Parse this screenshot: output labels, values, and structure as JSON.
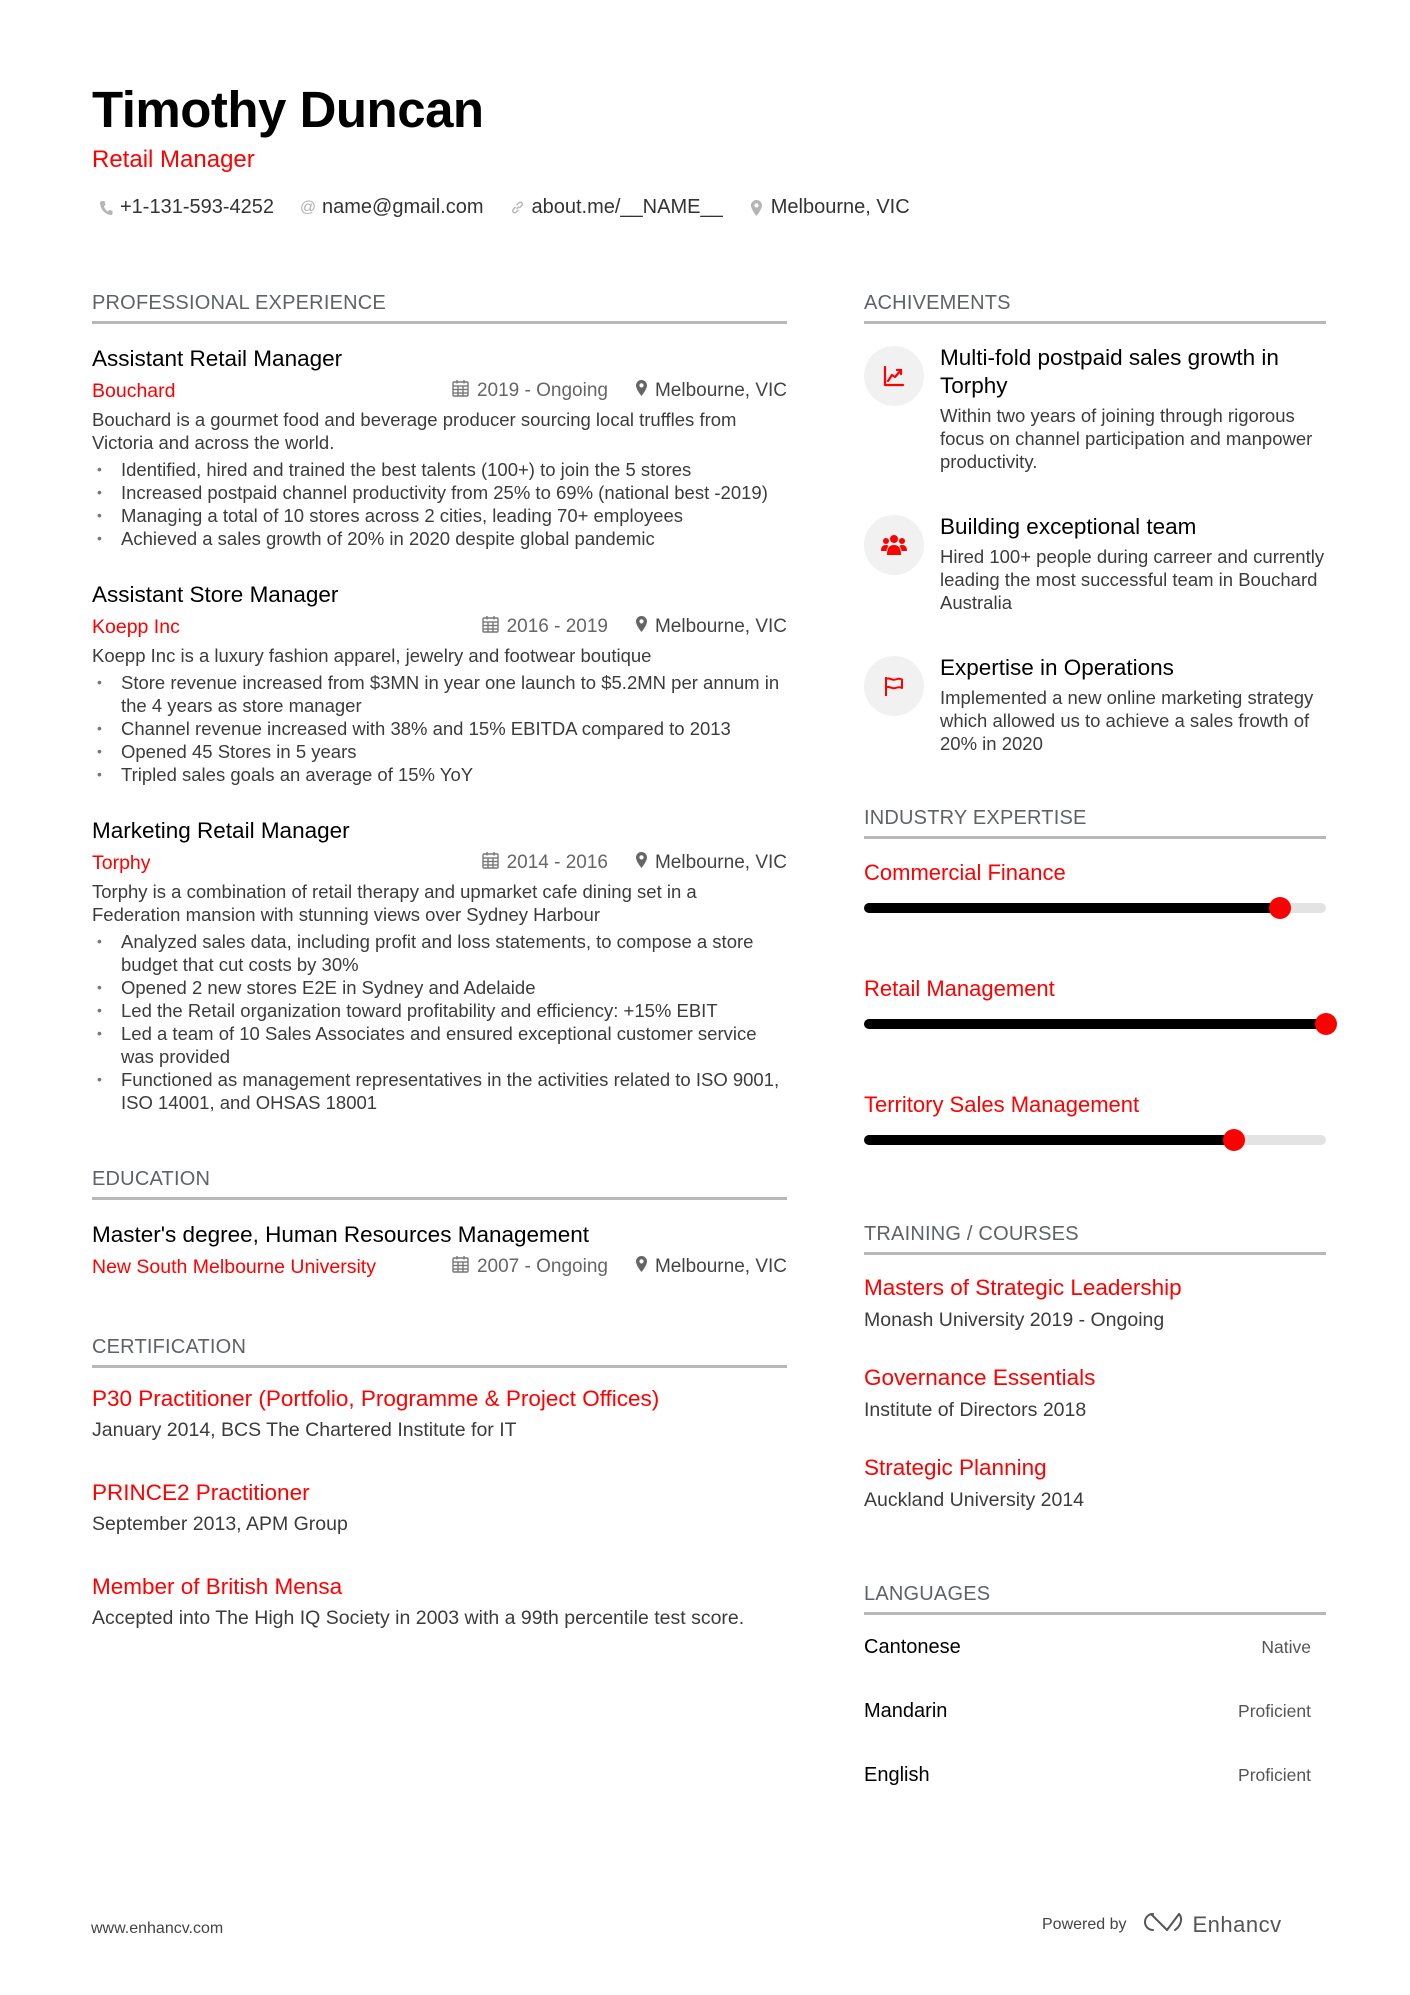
{
  "header": {
    "name": "Timothy Duncan",
    "role": "Retail Manager",
    "contacts": [
      {
        "icon": "phone-icon",
        "text": "+1-131-593-4252"
      },
      {
        "icon": "at-icon",
        "text": "name@gmail.com"
      },
      {
        "icon": "link-icon",
        "text": "about.me/__NAME__"
      },
      {
        "icon": "location-pin-icon",
        "text": "Melbourne, VIC"
      }
    ]
  },
  "experience": {
    "title": "PROFESSIONAL EXPERIENCE",
    "jobs": [
      {
        "title": "Assistant Retail Manager",
        "company": "Bouchard",
        "dates": "2019 - Ongoing",
        "location": "Melbourne, VIC",
        "description": "Bouchard is a gourmet food and beverage producer sourcing local truffles from Victoria and across the world.",
        "bullets": [
          "Identified, hired and trained the best talents (100+) to join the 5 stores",
          "Increased postpaid channel productivity from 25% to 69% (national best -2019)",
          "Managing a total of 10 stores across 2 cities, leading 70+ employees",
          "Achieved a sales growth of 20% in 2020 despite global pandemic"
        ]
      },
      {
        "title": "Assistant Store Manager",
        "company": "Koepp Inc",
        "dates": "2016 - 2019",
        "location": "Melbourne, VIC",
        "description": "Koepp Inc is a luxury fashion apparel, jewelry and footwear boutique",
        "bullets": [
          "Store revenue increased from $3MN in year one launch to $5.2MN per annum in the 4 years as store manager",
          "Channel revenue increased with 38% and 15% EBITDA compared to 2013",
          "Opened 45 Stores in 5 years",
          "Tripled sales goals an average of 15% YoY"
        ]
      },
      {
        "title": "Marketing Retail Manager",
        "company": "Torphy",
        "dates": "2014 - 2016",
        "location": "Melbourne, VIC",
        "description": "Torphy is a combination of retail therapy and upmarket cafe dining set in a Federation mansion with stunning views over Sydney Harbour",
        "bullets": [
          "Analyzed sales data, including profit and loss statements, to compose a store budget that cut costs by 30%",
          "Opened 2 new stores E2E in Sydney and Adelaide",
          "Led the Retail organization toward profitability and efficiency: +15% EBIT",
          "Led a team of 10 Sales Associates and ensured exceptional customer service was provided",
          "Functioned as management representatives in the activities related to ISO 9001, ISO 14001, and OHSAS 18001"
        ]
      }
    ]
  },
  "education": {
    "title": "EDUCATION",
    "items": [
      {
        "degree": "Master's degree, Human Resources Management",
        "school": "New South Melbourne University",
        "dates": "2007 - Ongoing",
        "location": "Melbourne, VIC"
      }
    ]
  },
  "certification": {
    "title": "CERTIFICATION",
    "items": [
      {
        "title": "P30 Practitioner (Portfolio, Programme & Project Offices)",
        "description": "January 2014, BCS The Chartered Institute for IT"
      },
      {
        "title": "PRINCE2 Practitioner",
        "description": "September 2013, APM Group"
      },
      {
        "title": "Member of British Mensa",
        "description": "Accepted into The High IQ Society in 2003 with a 99th percentile test score."
      }
    ]
  },
  "achievements": {
    "title": "ACHIVEMENTS",
    "items": [
      {
        "icon": "chart-line-icon",
        "title": "Multi-fold postpaid sales growth in Torphy",
        "description": "Within two years of joining through rigorous focus on channel participation and manpower productivity."
      },
      {
        "icon": "users-icon",
        "title": "Building exceptional team",
        "description": "Hired 100+ people during carreer and currently leading the most successful team in Bouchard Australia"
      },
      {
        "icon": "flag-icon",
        "title": "Expertise in Operations",
        "description": "Implemented a new online marketing strategy which allowed us to achieve a sales frowth of 20% in 2020"
      }
    ]
  },
  "expertise": {
    "title": "INDUSTRY EXPERTISE",
    "items": [
      {
        "name": "Commercial Finance",
        "level": 0.9
      },
      {
        "name": "Retail Management",
        "level": 1.0
      },
      {
        "name": "Territory Sales Management",
        "level": 0.8
      }
    ]
  },
  "training": {
    "title": "TRAINING / COURSES",
    "items": [
      {
        "title": "Masters of Strategic Leadership",
        "subtitle": "Monash University 2019 - Ongoing"
      },
      {
        "title": "Governance Essentials",
        "subtitle": "Institute of Directors 2018"
      },
      {
        "title": "Strategic Planning",
        "subtitle": "Auckland University 2014"
      }
    ]
  },
  "languages": {
    "title": "LANGUAGES",
    "items": [
      {
        "name": "Cantonese",
        "level": "Native"
      },
      {
        "name": "Mandarin",
        "level": "Proficient"
      },
      {
        "name": "English",
        "level": "Proficient"
      }
    ]
  },
  "footer": {
    "website": "www.enhancv.com",
    "powered_by": "Powered by",
    "brand": "Enhancv"
  },
  "colors": {
    "accent": "#ff0000",
    "section_rule": "#b8b8b8",
    "skill_fill": "#000000",
    "skill_track": "#e3e3e3",
    "icon_bg": "#f1f1f1"
  }
}
